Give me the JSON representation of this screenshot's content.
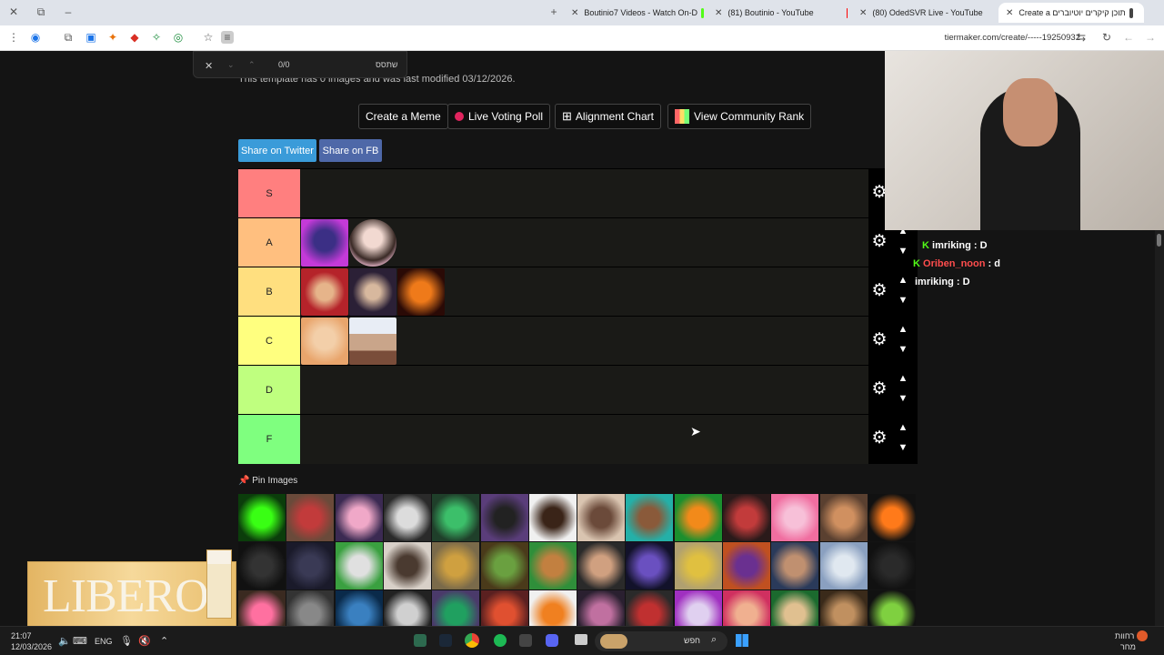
{
  "browser": {
    "tabs": [
      {
        "label": "Boutinio7 Videos - Watch On-D",
        "color": "#53fc18"
      },
      {
        "label": "(81) Boutinio - YouTube",
        "color": "#ff0000"
      },
      {
        "label": "(80) OdedSVR Live - YouTube",
        "color": "#ff0000"
      },
      {
        "label": "Create a תוכן קיקרים יוטיוברים",
        "color": "#444444"
      }
    ],
    "url": "tiermaker.com/create/-----19250932"
  },
  "findbar": {
    "count": "0/0",
    "query": "שתסס"
  },
  "page": {
    "subtitle": "This template has 0 images and was last modified 03/12/2026.",
    "buttons": {
      "meme": "Create a Meme",
      "poll": "Live Voting Poll",
      "alignment": "Alignment Chart",
      "community": "View Community Rank"
    },
    "share": {
      "twitter": "Share on Twitter",
      "fb": "Share on FB"
    },
    "pin_label": "Pin Images"
  },
  "tiers": [
    {
      "label": "S",
      "color": "#ff7f7f"
    },
    {
      "label": "A",
      "color": "#ffbf7f"
    },
    {
      "label": "B",
      "color": "#ffdf7f"
    },
    {
      "label": "C",
      "color": "#ffff7f"
    },
    {
      "label": "D",
      "color": "#bfff7f"
    },
    {
      "label": "F",
      "color": "#7fff7f"
    }
  ],
  "chat": [
    {
      "user": "imriking",
      "text": ": D",
      "color": "#ffffff"
    },
    {
      "user": "Oriben_noon",
      "text": ": d",
      "color": "#ff4d4d"
    },
    {
      "user": "imriking",
      "text": ": D",
      "color": "#ffffff"
    }
  ],
  "ad": {
    "brand": "LIBERO"
  },
  "taskbar": {
    "time": "21:07",
    "date": "12/03/2026",
    "lang": "ENG",
    "search": "חפש",
    "weather": "רחוות",
    "weather2": "מחר"
  }
}
